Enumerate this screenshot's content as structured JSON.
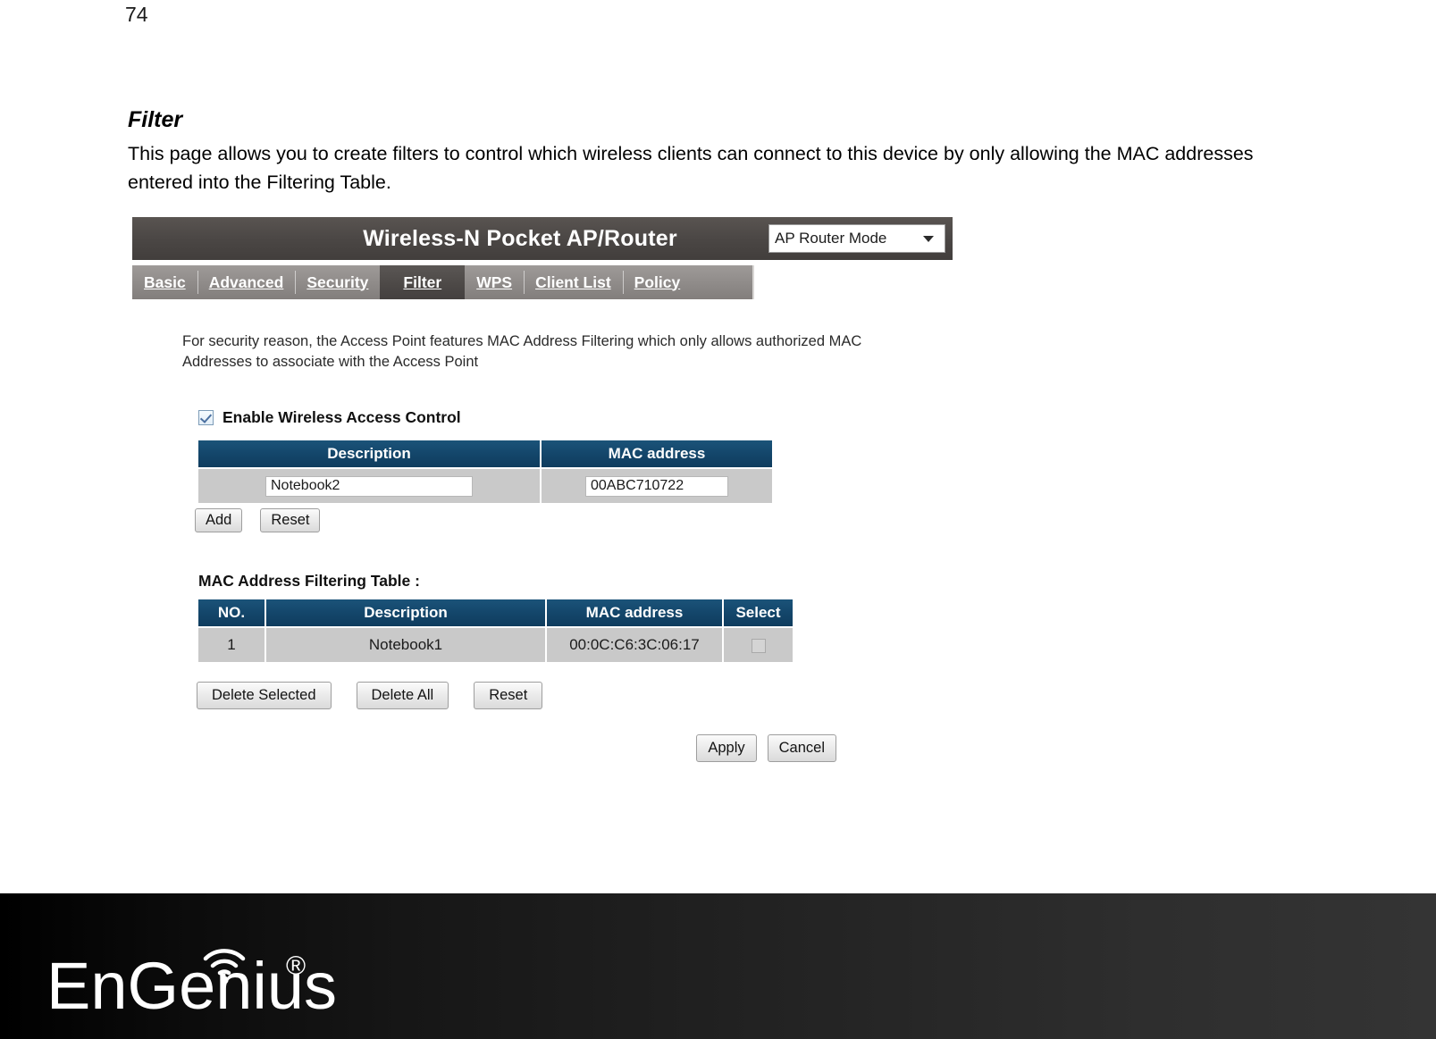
{
  "page": {
    "number": "74"
  },
  "doc": {
    "section_title": "Filter",
    "paragraph": "This page allows you to create filters to control which wireless clients can connect to this device by only allowing the MAC addresses entered into the Filtering Table."
  },
  "router": {
    "header": {
      "title": "Wireless-N Pocket AP/Router",
      "mode_select": {
        "value": "AP Router Mode",
        "icon": "chevron-down-icon"
      }
    },
    "tabs": [
      {
        "label": "Basic",
        "active": false
      },
      {
        "label": "Advanced",
        "active": false
      },
      {
        "label": "Security",
        "active": false
      },
      {
        "label": "Filter",
        "active": true
      },
      {
        "label": "WPS",
        "active": false
      },
      {
        "label": "Client List",
        "active": false
      },
      {
        "label": "Policy",
        "active": false
      }
    ],
    "help_text": "For security reason, the Access Point features MAC Address Filtering which only allows authorized MAC Addresses to associate with the Access Point",
    "enable_access_control": {
      "label": "Enable Wireless Access Control",
      "checked": true
    },
    "entry_table": {
      "headers": [
        "Description",
        "MAC address"
      ],
      "description_value": "Notebook2",
      "mac_value": "00ABC710722"
    },
    "entry_buttons": {
      "add": "Add",
      "reset": "Reset"
    },
    "filtering_table": {
      "title": "MAC Address Filtering Table :",
      "headers": [
        "NO.",
        "Description",
        "MAC address",
        "Select"
      ],
      "rows": [
        {
          "no": "1",
          "description": "Notebook1",
          "mac": "00:0C:C6:3C:06:17",
          "selected": false
        }
      ]
    },
    "table_buttons": {
      "delete_selected": "Delete Selected",
      "delete_all": "Delete All",
      "reset": "Reset"
    },
    "form_buttons": {
      "apply": "Apply",
      "cancel": "Cancel"
    },
    "colors": {
      "header_bar": "#4a4644",
      "tab_bar": "#908c8a",
      "tab_active": "#4c4846",
      "table_header": "#134569",
      "table_row": "#c9c9c9"
    }
  },
  "footer": {
    "brand": "EnGenius",
    "registered_mark": "®",
    "logo_icon": "wifi-signal-icon"
  }
}
